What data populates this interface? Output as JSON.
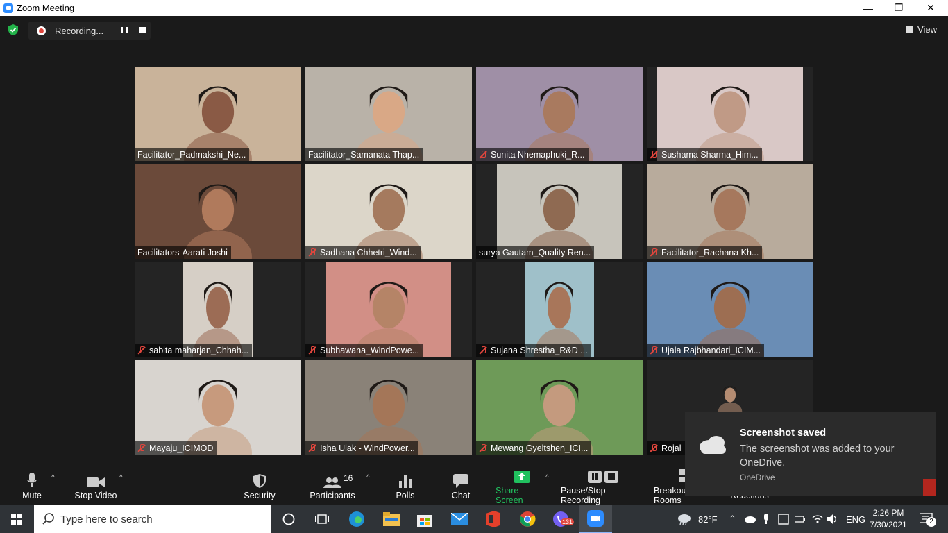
{
  "window": {
    "title": "Zoom Meeting",
    "minimize": "—",
    "maximize": "❐",
    "close": "✕"
  },
  "recording": {
    "label": "Recording..."
  },
  "view": {
    "label": "View"
  },
  "participants_grid": [
    {
      "name": "Facilitator_Padmakshi_Ne...",
      "muted": false,
      "active": false,
      "bg": "#c9b39a",
      "skin": "#8a5a45"
    },
    {
      "name": "Facilitator_Samanata Thap...",
      "muted": false,
      "active": true,
      "bg": "#b9b2a8",
      "skin": "#d9a886"
    },
    {
      "name": "Sunita Nhemaphuki_R...",
      "muted": true,
      "active": false,
      "bg": "#9f8fa6",
      "skin": "#a97a5f"
    },
    {
      "name": "Sushama Sharma_Him...",
      "muted": true,
      "active": false,
      "bg": "#d9c8c6",
      "skin": "#c09a86"
    },
    {
      "name": "Facilitators-Aarati Joshi",
      "muted": false,
      "active": false,
      "bg": "#6b4a3a",
      "skin": "#b07a5c"
    },
    {
      "name": "Sadhana Chhetri_Wind...",
      "muted": true,
      "active": false,
      "bg": "#dcd6c9",
      "skin": "#a57a5e"
    },
    {
      "name": "surya Gautam_Quality Ren...",
      "muted": false,
      "active": false,
      "bg": "#c7c4bb",
      "skin": "#8f6a52"
    },
    {
      "name": "Facilitator_Rachana Kh...",
      "muted": true,
      "active": false,
      "bg": "#b8ab9c",
      "skin": "#a6785d"
    },
    {
      "name": "sabita maharjan_Chhah...",
      "muted": true,
      "active": false,
      "bg": "#d6cfc6",
      "skin": "#9c6c55"
    },
    {
      "name": "Subhawana_WindPowe...",
      "muted": true,
      "active": false,
      "bg": "#d28f86",
      "skin": "#b58467"
    },
    {
      "name": "Sujana Shrestha_R&D ...",
      "muted": true,
      "active": false,
      "bg": "#9fc0c9",
      "skin": "#a8765a"
    },
    {
      "name": "Ujala Rajbhandari_ICIM...",
      "muted": true,
      "active": false,
      "bg": "#6a8db5",
      "skin": "#9d6e52"
    },
    {
      "name": "Mayaju_ICIMOD",
      "muted": true,
      "active": false,
      "bg": "#d8d4cf",
      "skin": "#c79a7d"
    },
    {
      "name": "Isha Ulak - WindPower...",
      "muted": true,
      "active": false,
      "bg": "#8a8278",
      "skin": "#a47658"
    },
    {
      "name": "Mewang Gyeltshen_ICI...",
      "muted": true,
      "active": false,
      "bg": "#6e9a58",
      "skin": "#c49a7e"
    },
    {
      "name": "Rojal",
      "muted": true,
      "active": false,
      "bg": "#242424",
      "skin": "#b48c72"
    }
  ],
  "toast": {
    "title": "Screenshot saved",
    "body": "The screenshot was added to your OneDrive.",
    "source": "OneDrive"
  },
  "toolbar": {
    "mute": "Mute",
    "stop_video": "Stop Video",
    "security": "Security",
    "participants": "Participants",
    "participants_count": "16",
    "polls": "Polls",
    "chat": "Chat",
    "share_screen": "Share Screen",
    "pause_stop_recording": "Pause/Stop Recording",
    "breakout_rooms": "Breakout Rooms",
    "reactions": "Reactions"
  },
  "taskbar": {
    "search_placeholder": "Type here to search",
    "weather": "82°F",
    "language": "ENG",
    "time": "2:26 PM",
    "date": "7/30/2021",
    "notifications_count": "2",
    "viber_badge": "131"
  },
  "colors": {
    "accent_green": "#21c15f",
    "active_speaker": "#e6f06a",
    "muted_red": "#e0463d",
    "zoom_blue": "#2d8cff"
  }
}
